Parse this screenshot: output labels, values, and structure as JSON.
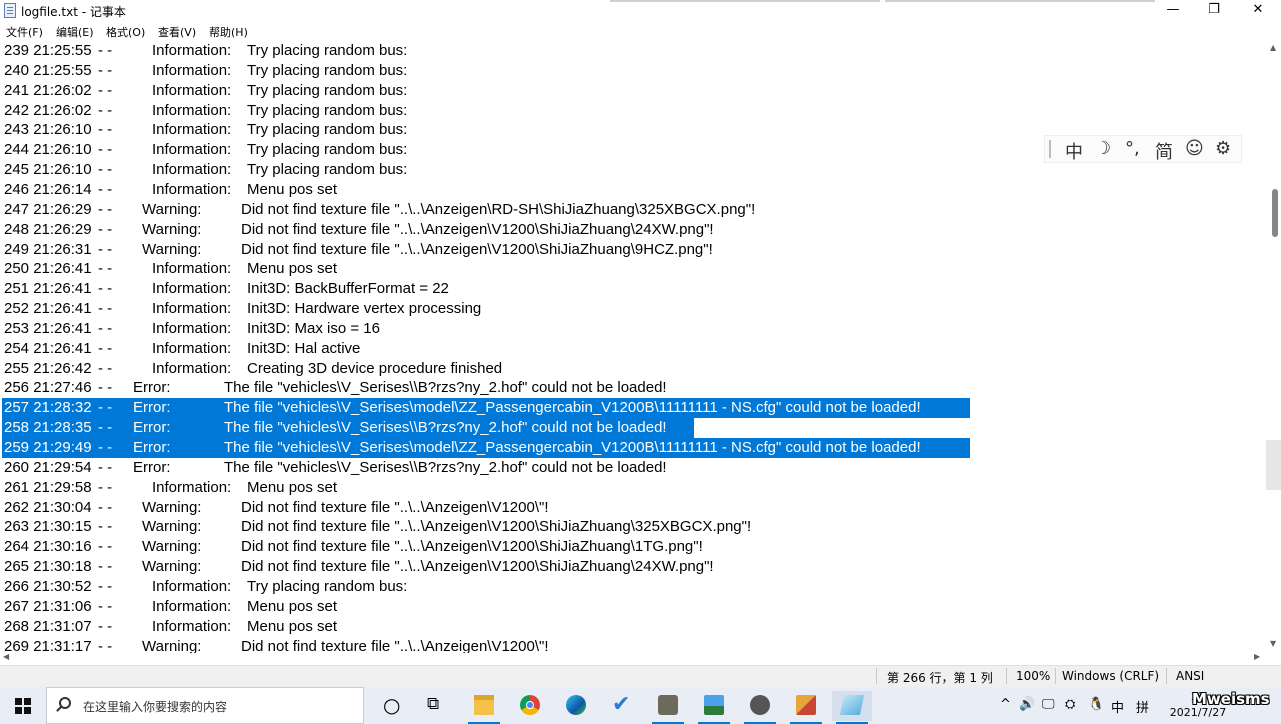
{
  "window": {
    "title": "logfile.txt - 记事本",
    "minimize_glyph": "—",
    "maximize_glyph": "❐",
    "close_glyph": "✕"
  },
  "menu": [
    "文件(F)",
    "编辑(E)",
    "格式(O)",
    "查看(V)",
    "帮助(H)"
  ],
  "lines": [
    {
      "num": "239",
      "time": "21:25:55",
      "dash": "-  -",
      "type": "Information:",
      "msg": "Try placing random bus:",
      "selected": false
    },
    {
      "num": "240",
      "time": "21:25:55",
      "dash": "-  -",
      "type": "Information:",
      "msg": "Try placing random bus:",
      "selected": false
    },
    {
      "num": "241",
      "time": "21:26:02",
      "dash": "-  -",
      "type": "Information:",
      "msg": "Try placing random bus:",
      "selected": false
    },
    {
      "num": "242",
      "time": "21:26:02",
      "dash": "-  -",
      "type": "Information:",
      "msg": "Try placing random bus:",
      "selected": false
    },
    {
      "num": "243",
      "time": "21:26:10",
      "dash": "-  -",
      "type": "Information:",
      "msg": "Try placing random bus:",
      "selected": false
    },
    {
      "num": "244",
      "time": "21:26:10",
      "dash": "-  -",
      "type": "Information:",
      "msg": "Try placing random bus:",
      "selected": false
    },
    {
      "num": "245",
      "time": "21:26:10",
      "dash": "-  -",
      "type": "Information:",
      "msg": "Try placing random bus:",
      "selected": false
    },
    {
      "num": "246",
      "time": "21:26:14",
      "dash": "-  -",
      "type": "Information:",
      "msg": "Menu pos set",
      "selected": false
    },
    {
      "num": "247",
      "time": "21:26:29",
      "dash": "-  -",
      "type": "Warning:",
      "msg": "Did not find texture file \"..\\..\\Anzeigen\\RD-SH\\ShiJiaZhuang\\325XBGCX.png\"!",
      "selected": false
    },
    {
      "num": "248",
      "time": "21:26:29",
      "dash": "-  -",
      "type": "Warning:",
      "msg": "Did not find texture file \"..\\..\\Anzeigen\\V1200\\ShiJiaZhuang\\24XW.png\"!",
      "selected": false
    },
    {
      "num": "249",
      "time": "21:26:31",
      "dash": "-  -",
      "type": "Warning:",
      "msg": "Did not find texture file \"..\\..\\Anzeigen\\V1200\\ShiJiaZhuang\\9HCZ.png\"!",
      "selected": false
    },
    {
      "num": "250",
      "time": "21:26:41",
      "dash": "-  -",
      "type": "Information:",
      "msg": "Menu pos set",
      "selected": false
    },
    {
      "num": "251",
      "time": "21:26:41",
      "dash": "-  -",
      "type": "Information:",
      "msg": "Init3D: BackBufferFormat = 22",
      "selected": false
    },
    {
      "num": "252",
      "time": "21:26:41",
      "dash": "-  -",
      "type": "Information:",
      "msg": "Init3D: Hardware vertex processing",
      "selected": false
    },
    {
      "num": "253",
      "time": "21:26:41",
      "dash": "-  -",
      "type": "Information:",
      "msg": "Init3D: Max iso = 16",
      "selected": false
    },
    {
      "num": "254",
      "time": "21:26:41",
      "dash": "-  -",
      "type": "Information:",
      "msg": "Init3D: Hal active",
      "selected": false
    },
    {
      "num": "255",
      "time": "21:26:42",
      "dash": "-  -",
      "type": "Information:",
      "msg": "Creating 3D device procedure finished",
      "selected": false
    },
    {
      "num": "256",
      "time": "21:27:46",
      "dash": "-  -",
      "type": "Error:",
      "msg": "The file \"vehicles\\V_Serises\\\\B?rzs?ny_2.hof\" could not be loaded!",
      "selected": false
    },
    {
      "num": "257",
      "time": "21:28:32",
      "dash": "-  -",
      "type": "Error:",
      "msg": "The file \"vehicles\\V_Serises\\model\\ZZ_Passengercabin_V1200B\\11111111 - NS.cfg\" could not be loaded!",
      "selected": true
    },
    {
      "num": "258",
      "time": "21:28:35",
      "dash": "-  -",
      "type": "Error:",
      "msg": "The file \"vehicles\\V_Serises\\\\B?rzs?ny_2.hof\" could not be loaded!",
      "selected": true
    },
    {
      "num": "259",
      "time": "21:29:49",
      "dash": "-  -",
      "type": "Error:",
      "msg": "The file \"vehicles\\V_Serises\\model\\ZZ_Passengercabin_V1200B\\11111111 - NS.cfg\" could not be loaded!",
      "selected": true
    },
    {
      "num": "260",
      "time": "21:29:54",
      "dash": "-  -",
      "type": "Error:",
      "msg": "The file \"vehicles\\V_Serises\\\\B?rzs?ny_2.hof\" could not be loaded!",
      "selected": false
    },
    {
      "num": "261",
      "time": "21:29:58",
      "dash": "-  -",
      "type": "Information:",
      "msg": "Menu pos set",
      "selected": false
    },
    {
      "num": "262",
      "time": "21:30:04",
      "dash": "-  -",
      "type": "Warning:",
      "msg": "Did not find texture file \"..\\..\\Anzeigen\\V1200\\\"!",
      "selected": false
    },
    {
      "num": "263",
      "time": "21:30:15",
      "dash": "-  -",
      "type": "Warning:",
      "msg": "Did not find texture file \"..\\..\\Anzeigen\\V1200\\ShiJiaZhuang\\325XBGCX.png\"!",
      "selected": false
    },
    {
      "num": "264",
      "time": "21:30:16",
      "dash": "-  -",
      "type": "Warning:",
      "msg": "Did not find texture file \"..\\..\\Anzeigen\\V1200\\ShiJiaZhuang\\1TG.png\"!",
      "selected": false
    },
    {
      "num": "265",
      "time": "21:30:18",
      "dash": "-  -",
      "type": "Warning:",
      "msg": "Did not find texture file \"..\\..\\Anzeigen\\V1200\\ShiJiaZhuang\\24XW.png\"!",
      "selected": false
    },
    {
      "num": "266",
      "time": "21:30:52",
      "dash": "-  -",
      "type": "Information:",
      "msg": "Try placing random bus:",
      "selected": false
    },
    {
      "num": "267",
      "time": "21:31:06",
      "dash": "-  -",
      "type": "Information:",
      "msg": "Menu pos set",
      "selected": false
    },
    {
      "num": "268",
      "time": "21:31:07",
      "dash": "-  -",
      "type": "Information:",
      "msg": "Menu pos set",
      "selected": false
    },
    {
      "num": "269",
      "time": "21:31:17",
      "dash": "-  -",
      "type": "Warning:",
      "msg": "Did not find texture file \"..\\..\\Anzeigen\\V1200\\\"!",
      "selected": false
    }
  ],
  "ime_toolbar": {
    "mode_char": "中",
    "moon_glyph": "☽",
    "punct_glyph": "°,",
    "simplified_char": "简",
    "emoji_glyph": "☺",
    "settings_glyph": "⚙"
  },
  "status": {
    "position": "第 266 行，第 1 列",
    "zoom": "100%",
    "line_ending": "Windows (CRLF)",
    "encoding": "ANSI"
  },
  "taskbar": {
    "search_placeholder": "在这里输入你要搜索的内容",
    "cortana_glyph": "○",
    "taskview_glyph": "⧉",
    "tray": {
      "chevron": "^",
      "volume": "🔊",
      "network": "🖵",
      "bluetooth": "⛭",
      "qq": "🐧",
      "ime_lang": "中",
      "ime_mode": "拼",
      "clock_time": "22",
      "clock_date": "2021/7/27"
    }
  },
  "watermark": "Mweisms",
  "colors": {
    "selection": "#0078d7",
    "taskbar_bg": "#e9eef6",
    "status_bg": "#f0f0f0"
  }
}
